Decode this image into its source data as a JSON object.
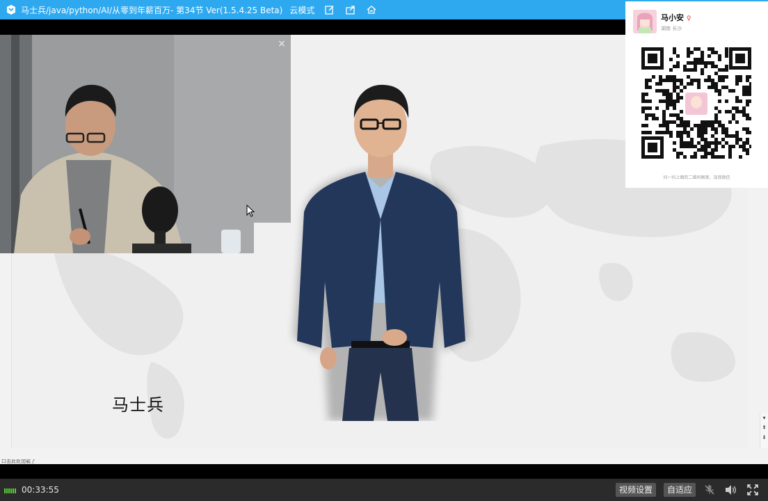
{
  "titlebar": {
    "title": "马士兵/java/python/AI/从零到年薪百万- 第34节 Ver(1.5.4.25 Beta)",
    "mode": "云模式",
    "icons": [
      "app-logo-icon",
      "edit-icon",
      "share-icon",
      "home-icon"
    ]
  },
  "camera": {
    "close_label": "×"
  },
  "slide": {
    "name": "马士兵"
  },
  "status": {
    "hint": "口击此处加载了"
  },
  "bottombar": {
    "time": "00:33:55",
    "video_settings": "视频设置",
    "adaptive": "自适应",
    "icons": [
      "mic-muted-icon",
      "speaker-icon",
      "fullscreen-icon"
    ]
  },
  "qr_panel": {
    "name": "马小安",
    "gender_mark": "♀",
    "region": "湖南 长沙",
    "caption": "扫一扫上面的二维码图案，加我微信"
  },
  "colors": {
    "titlebar": "#2ea9f0",
    "signal": "#5ad03a",
    "bottombar": "#2b2b2b"
  }
}
